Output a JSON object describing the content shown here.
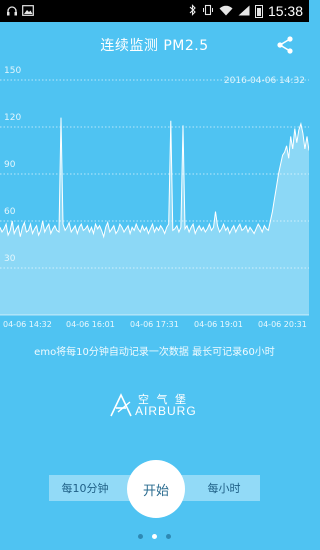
{
  "status_bar": {
    "time": "15:38",
    "left_icons": [
      "headphones-icon",
      "image-icon"
    ],
    "right_icons": [
      "bluetooth-icon",
      "vibrate-icon",
      "wifi-icon",
      "signal-icon",
      "battery-icon"
    ]
  },
  "header": {
    "title": "连续监测 PM2.5",
    "share_icon": "share-icon"
  },
  "chart": {
    "timestamp": "2016-04-06 14:32"
  },
  "chart_data": {
    "type": "area",
    "y_ticks": [
      "150",
      "120",
      "90",
      "60",
      "30"
    ],
    "x_ticks": [
      "04-06 14:32",
      "04-06 16:01",
      "04-06 17:31",
      "04-06 19:01",
      "04-06 20:31"
    ],
    "ylim": [
      0,
      150
    ],
    "grid": true,
    "values": [
      56,
      53,
      55,
      58,
      51,
      54,
      60,
      52,
      55,
      57,
      50,
      56,
      59,
      53,
      54,
      58,
      52,
      55,
      57,
      51,
      54,
      60,
      53,
      56,
      58,
      52,
      55,
      57,
      54,
      53,
      126,
      58,
      54,
      56,
      59,
      53,
      55,
      57,
      52,
      56,
      58,
      54,
      55,
      57,
      53,
      56,
      52,
      58,
      55,
      57,
      54,
      50,
      56,
      59,
      53,
      55,
      57,
      52,
      54,
      58,
      56,
      53,
      55,
      57,
      52,
      56,
      54,
      58,
      55,
      53,
      57,
      54,
      56,
      52,
      55,
      58,
      53,
      56,
      54,
      57,
      55,
      52,
      56,
      58,
      124,
      54,
      55,
      57,
      53,
      56,
      121,
      55,
      57,
      53,
      56,
      58,
      52,
      55,
      57,
      54,
      56,
      53,
      55,
      58,
      54,
      56,
      66,
      57,
      53,
      55,
      58,
      54,
      56,
      52,
      55,
      57,
      53,
      56,
      58,
      54,
      55,
      57,
      53,
      56,
      54,
      52,
      55,
      58,
      56,
      53,
      57,
      55,
      54,
      60,
      66,
      74,
      82,
      90,
      96,
      102,
      104,
      108,
      100,
      114,
      106,
      119,
      110,
      118,
      122,
      116,
      106,
      114,
      105
    ]
  },
  "caption": "emo将每10分钟自动记录一次数据 最长可记录60小时",
  "logo": {
    "chinese": "空 气 堡",
    "english": "AIRBURG"
  },
  "controls": {
    "left_option": "每10分钟",
    "start_label": "开始",
    "right_option": "每小时"
  },
  "pager": {
    "count": 3,
    "active": 1
  }
}
